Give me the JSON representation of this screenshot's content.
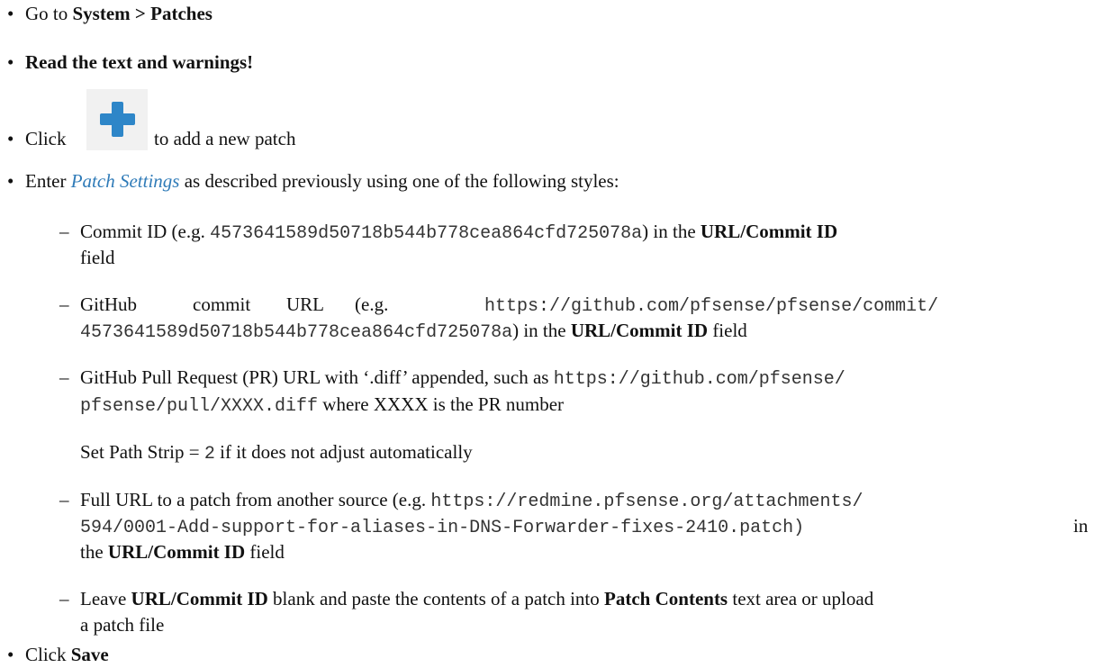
{
  "bullet": "•",
  "dash": "–",
  "goto": {
    "prefix": "Go to ",
    "path": "System > Patches"
  },
  "read": "Read the text and warnings!",
  "click_add": {
    "prefix": "Click",
    "suffix": "to add a new patch",
    "icon": "plus-icon",
    "icon_color": "#2e86c8"
  },
  "enter": {
    "prefix": "Enter ",
    "link": "Patch Settings",
    "suffix": " as described previously using one of the following styles:"
  },
  "styles": {
    "commit_id": {
      "a": "Commit ID (e.g. ",
      "code": "4573641589d50718b544b778cea864cfd725078a",
      "b": ") in the ",
      "field": "URL/Commit ID",
      "c": "field"
    },
    "github_commit": {
      "a1": "GitHub",
      "a2": "commit",
      "a3": "URL",
      "a4": "(e.g.",
      "code1": "https://github.com/pfsense/pfsense/commit/",
      "code2": "4573641589d50718b544b778cea864cfd725078a",
      "b": ") in the ",
      "field": "URL/Commit ID",
      "c": " field"
    },
    "github_pr": {
      "a": "GitHub Pull Request (PR) URL with ‘.diff’ appended, such as ",
      "code1": "https://github.com/pfsense/",
      "code2": "pfsense/pull/XXXX.diff",
      "b": " where XXXX is the PR number",
      "strip_a": "Set Path Strip = ",
      "strip_code": "2",
      "strip_b": " if it does not adjust automatically"
    },
    "full_url": {
      "a": "Full URL to a patch from another source (e.g. ",
      "code1": "https://redmine.pfsense.org/attachments/",
      "code2": "594/0001-Add-support-for-aliases-in-DNS-Forwarder-fixes-2410.patch)",
      "in": "in",
      "b": "the ",
      "field": "URL/Commit ID",
      "c": " field"
    },
    "leave_blank": {
      "a": "Leave ",
      "field": "URL/Commit ID",
      "b": " blank and paste the contents of a patch into ",
      "field2": "Patch Contents",
      "c": " text area or upload",
      "d": "a patch file"
    }
  },
  "save": {
    "prefix": "Click ",
    "label": "Save"
  }
}
